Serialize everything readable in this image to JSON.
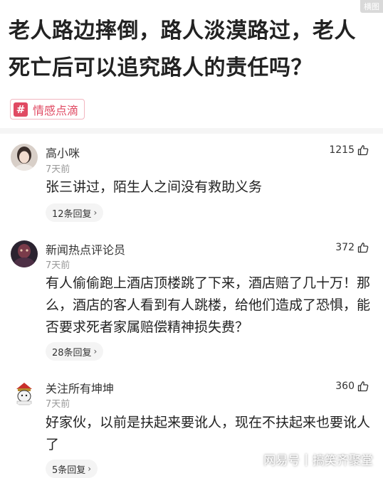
{
  "corner_tag": "横图",
  "title": "老人路边摔倒，路人淡漠路过，老人死亡后可以追究路人的责任吗？",
  "topic": {
    "hash": "#",
    "label": "情感点滴"
  },
  "comments": [
    {
      "username": "高小咪",
      "time": "7天前",
      "likes": "1215",
      "text": "张三讲过，陌生人之间没有救助义务",
      "replies": "12条回复"
    },
    {
      "username": "新闻热点评论员",
      "time": "7天前",
      "likes": "372",
      "text": "有人偷偷跑上酒店顶楼跳了下来，酒店赔了几十万！那么，酒店的客人看到有人跳楼，给他们造成了恐惧，能否要求死者家属赔偿精神损失费？",
      "replies": "28条回复"
    },
    {
      "username": "关注所有坤坤",
      "time": "7天前",
      "likes": "360",
      "text": "好家伙，以前是扶起来要讹人，现在不扶起来也要讹人了",
      "replies": "5条回复"
    }
  ],
  "watermark": {
    "brand": "网易号",
    "author": "搞笑齐聚堂"
  },
  "icons": {
    "like": "thumbs-up-icon",
    "chevron": "chevron-right-icon",
    "topic": "hash-icon"
  }
}
